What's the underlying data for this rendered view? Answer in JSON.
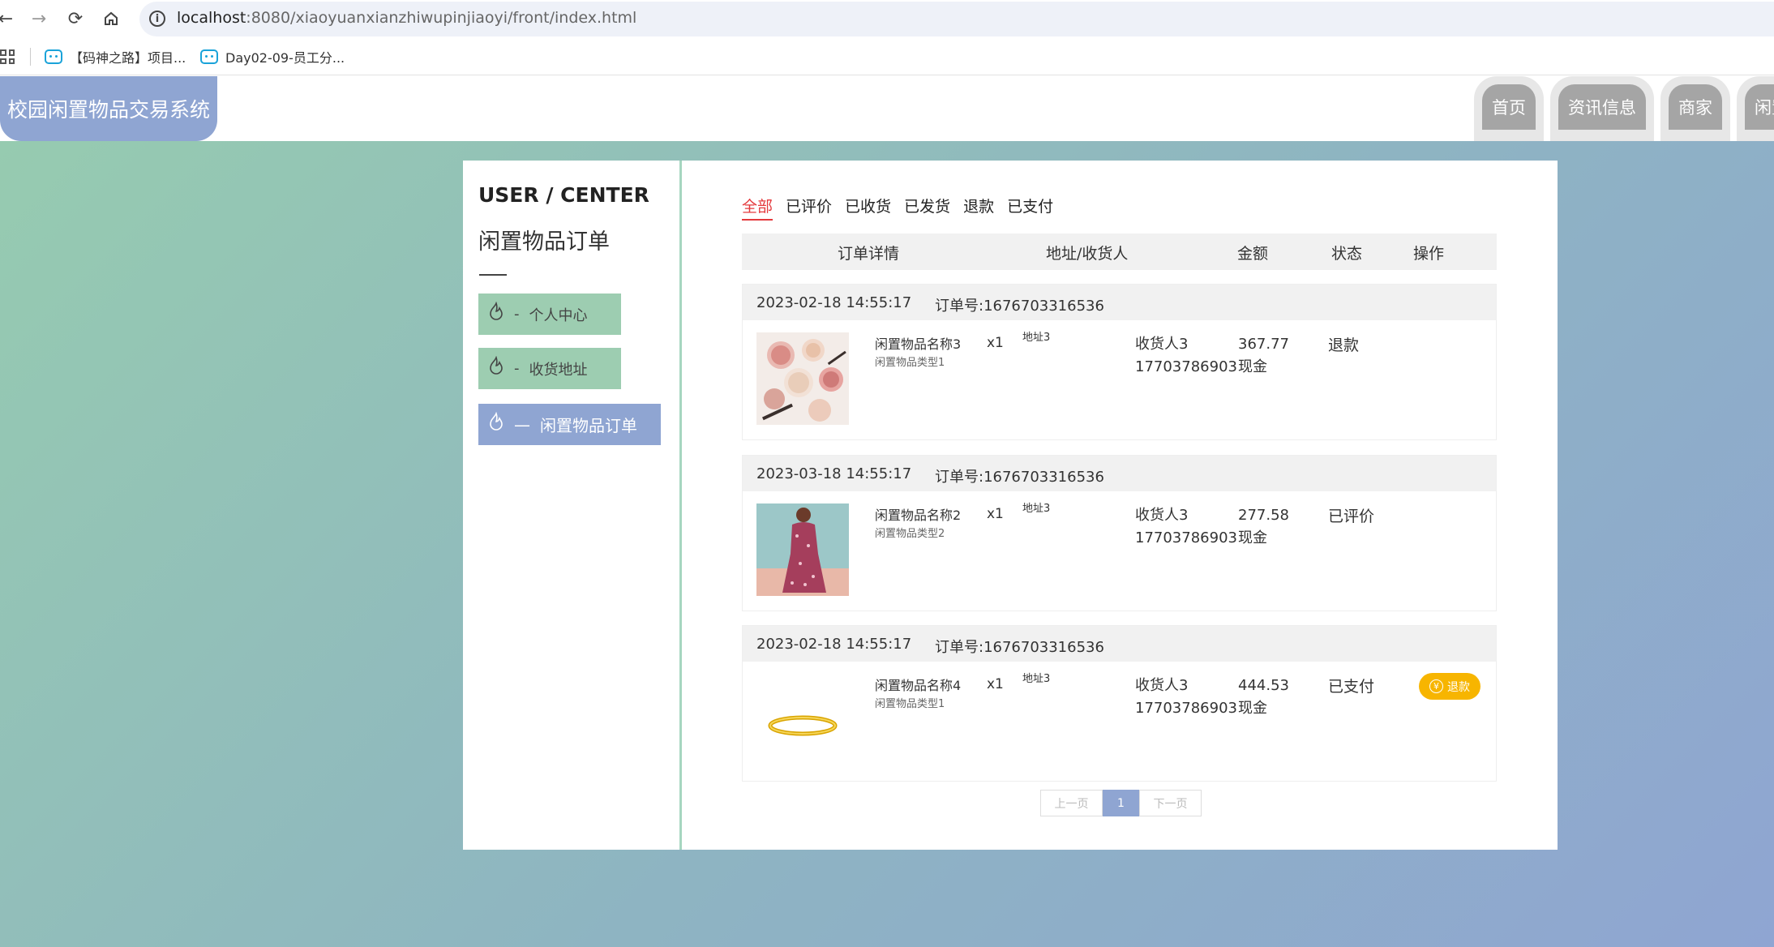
{
  "browser": {
    "url_host": "localhost",
    "url_rest": ":8080/xiaoyuanxianzhiwupinjiaoyi/front/index.html",
    "bookmarks": [
      "【码神之路】项目...",
      "Day02-09-员工分..."
    ]
  },
  "header": {
    "site_title": "校园闲置物品交易系统",
    "nav": [
      "首页",
      "资讯信息",
      "商家",
      "闲置"
    ]
  },
  "sidebar": {
    "title": "USER / CENTER",
    "subtitle": "闲置物品订单",
    "items": [
      {
        "prefix": "-",
        "label": "个人中心"
      },
      {
        "prefix": "-",
        "label": "收货地址"
      },
      {
        "prefix": "—",
        "label": "闲置物品订单"
      }
    ]
  },
  "main": {
    "tabs": [
      "全部",
      "已评价",
      "已收货",
      "已发货",
      "退款",
      "已支付"
    ],
    "active_tab": "全部",
    "columns": [
      "订单详情",
      "地址/收货人",
      "金额",
      "状态",
      "操作"
    ],
    "orders": [
      {
        "date": "2023-02-18 14:55:17",
        "order_no": "订单号:1676703316536",
        "name": "闲置物品名称3",
        "type": "闲置物品类型1",
        "qty": "x1",
        "address": "地址3",
        "receiver": "收货人3",
        "phone": "17703786903",
        "amount": "367.77",
        "pay": "现金",
        "status": "退款",
        "image": "cosmetics-photo"
      },
      {
        "date": "2023-03-18 14:55:17",
        "order_no": "订单号:1676703316536",
        "name": "闲置物品名称2",
        "type": "闲置物品类型2",
        "qty": "x1",
        "address": "地址3",
        "receiver": "收货人3",
        "phone": "17703786903",
        "amount": "277.58",
        "pay": "现金",
        "status": "已评价",
        "image": "dress-photo"
      },
      {
        "date": "2023-02-18 14:55:17",
        "order_no": "订单号:1676703316536",
        "name": "闲置物品名称4",
        "type": "闲置物品类型1",
        "qty": "x1",
        "address": "地址3",
        "receiver": "收货人3",
        "phone": "17703786903",
        "amount": "444.53",
        "pay": "现金",
        "status": "已支付",
        "image": "bracelet-photo",
        "action": "退款"
      }
    ],
    "pager": {
      "prev": "上一页",
      "current": "1",
      "next": "下一页"
    }
  },
  "colors": {
    "logo_bg": "#8fa5d2",
    "menu_green": "#9dcdb1",
    "menu_active": "#8fa5d2",
    "tab_active": "#e4393c",
    "refund_btn": "#f7b500"
  }
}
